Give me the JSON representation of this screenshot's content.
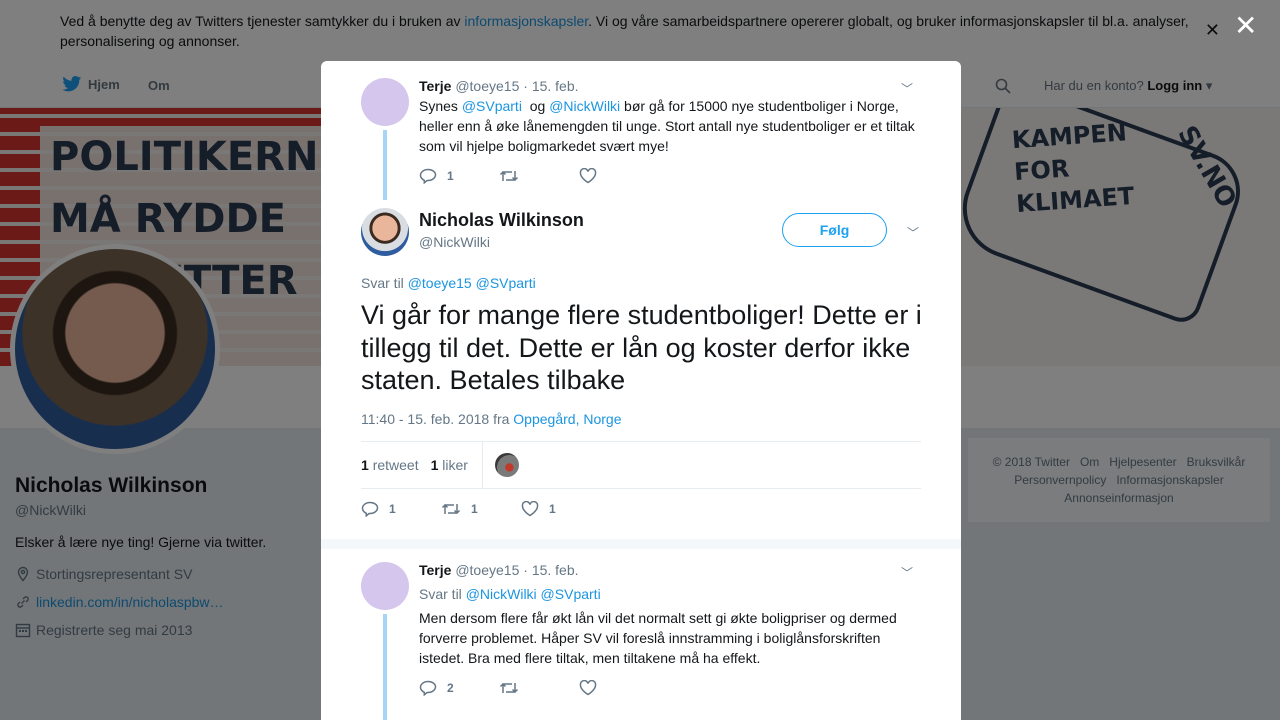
{
  "cookie": {
    "text_before": "Ved å benytte deg av Twitters tjenester samtykker du i bruken av ",
    "link": "informasjonskapsler",
    "text_after": ". Vi og våre samarbeidspartnere opererer globalt, og bruker informasjonskapsler til bl.a. analyser, personalisering og annonser."
  },
  "nav": {
    "home": "Hjem",
    "about": "Om",
    "login_prompt": "Har du en konto?",
    "login": "Logg inn"
  },
  "banner": {
    "left_text": "POLITIKERNE MÅ RYDDE OPP ETTER EGEN",
    "right_text": "KAMPEN FOR KLIMAET",
    "right_sv": "SV.NO"
  },
  "profile": {
    "name": "Nicholas Wilkinson",
    "handle": "@NickWilki",
    "bio": "Elsker å lære nye ting! Gjerne via twitter.",
    "location": "Stortingsrepresentant SV",
    "url": "linkedin.com/in/nicholaspbw…",
    "joined": "Registrerte seg mai 2013"
  },
  "footer": {
    "links": [
      "© 2018 Twitter",
      "Om",
      "Hjelpesenter",
      "Bruksvilkår",
      "Personvernpolicy",
      "Informasjonskapsler",
      "Annonseinformasjon"
    ]
  },
  "tweet1": {
    "name": "Terje",
    "handle": "@toeye15",
    "date": "· 15. feb.",
    "text_a": "Synes ",
    "mention1": "@SVparti",
    "text_b": "  og ",
    "mention2": "@NickWilki",
    "text_c": " bør gå for 15000 nye studentboliger i Norge, heller enn å øke lånemengden til unge. Stort antall nye studentboliger er et tiltak som vil hjelpe boligmarkedet svært mye!",
    "replies": "1"
  },
  "main_tweet": {
    "name": "Nicholas Wilkinson",
    "handle": "@NickWilki",
    "follow": "Følg",
    "reply_to_label": "Svar til",
    "reply_to": "@toeye15 @SVparti",
    "text": "Vi går for mange flere studentboliger! Dette er i tillegg til det. Dette er lån og koster derfor ikke staten. Betales tilbake",
    "time": "11:40 - 15. feb. 2018 fra",
    "place": "Oppegård, Norge",
    "retweet_count": "1",
    "retweet_label": "retweet",
    "like_count": "1",
    "like_label": "liker",
    "replies": "1",
    "retweets": "1",
    "likes": "1"
  },
  "tweet3": {
    "name": "Terje",
    "handle": "@toeye15",
    "date": "· 15. feb.",
    "reply_to_label": "Svar til",
    "reply_to": "@NickWilki @SVparti",
    "text": "Men dersom flere får økt lån vil det normalt sett gi økte boligpriser og dermed forverre problemet. Håper SV vil foreslå innstramming i boliglånsforskriften istedet. Bra med flere tiltak, men tiltakene må ha effekt.",
    "replies": "2"
  },
  "colors": {
    "accent": "#1da1f2",
    "link": "#1b95e0",
    "thread": "#a7d5f5"
  }
}
